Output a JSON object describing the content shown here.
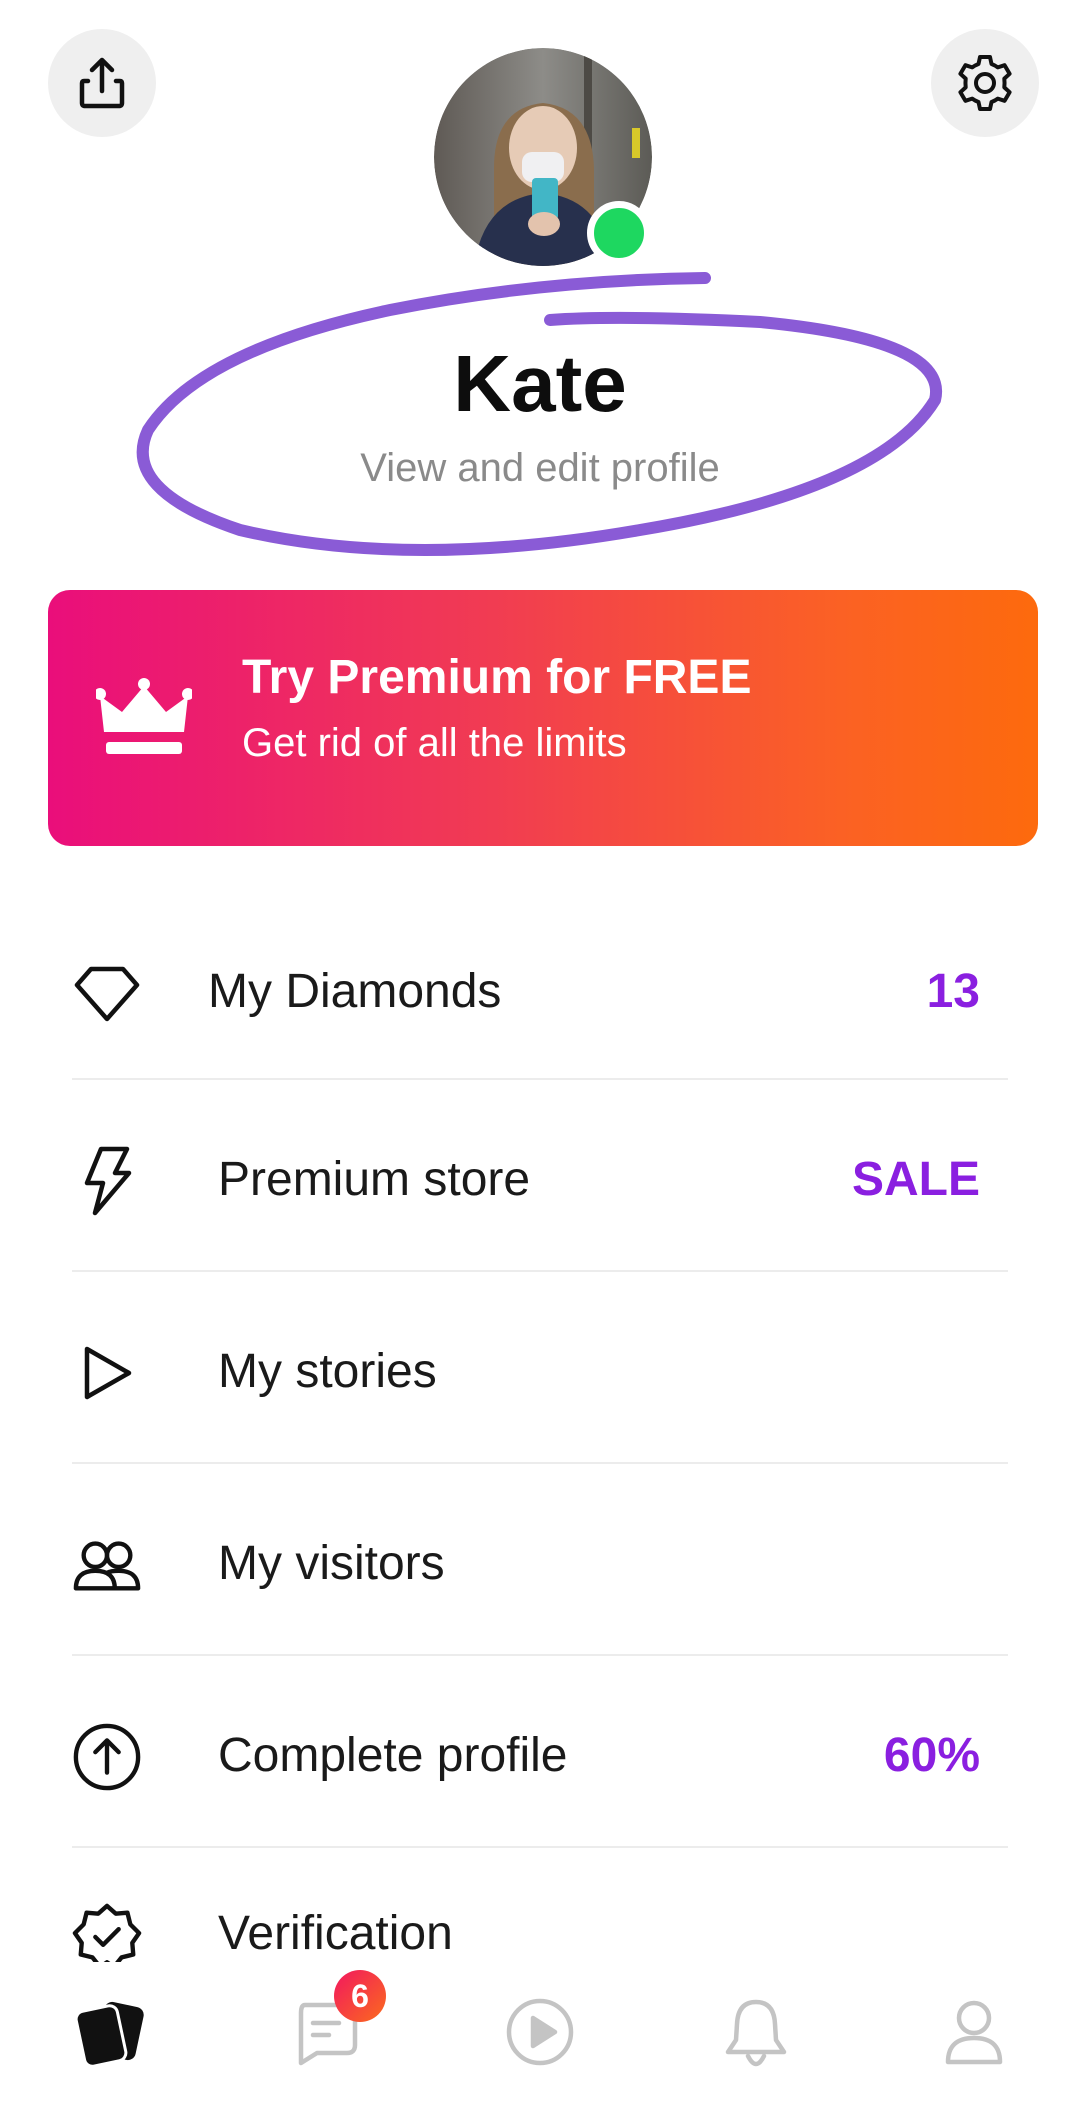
{
  "header": {
    "share_icon": "share-icon",
    "settings_icon": "gear-icon"
  },
  "profile": {
    "name": "Kate",
    "subtitle": "View and edit profile",
    "online_status_color": "#1ed760",
    "annotation_color": "#8a5bd6"
  },
  "premium_banner": {
    "icon": "crown-icon",
    "title": "Try Premium for FREE",
    "subtitle": "Get rid of all the limits",
    "gradient_start": "#ea0e7b",
    "gradient_end": "#fd6a0d"
  },
  "menu": {
    "accent_color": "#8a1fe0",
    "items": [
      {
        "icon": "diamond-icon",
        "label": "My Diamonds",
        "value": "13"
      },
      {
        "icon": "lightning-icon",
        "label": "Premium store",
        "value": "SALE"
      },
      {
        "icon": "play-outline-icon",
        "label": "My stories",
        "value": ""
      },
      {
        "icon": "users-icon",
        "label": "My visitors",
        "value": ""
      },
      {
        "icon": "arrow-up-circle-icon",
        "label": "Complete profile",
        "value": "60%"
      },
      {
        "icon": "verified-badge-icon",
        "label": "Verification",
        "value": ""
      }
    ]
  },
  "bottom_nav": {
    "items": [
      {
        "icon": "cards-icon",
        "active": true
      },
      {
        "icon": "chat-icon",
        "badge": "6"
      },
      {
        "icon": "play-circle-icon"
      },
      {
        "icon": "bell-icon"
      },
      {
        "icon": "profile-icon"
      }
    ]
  }
}
